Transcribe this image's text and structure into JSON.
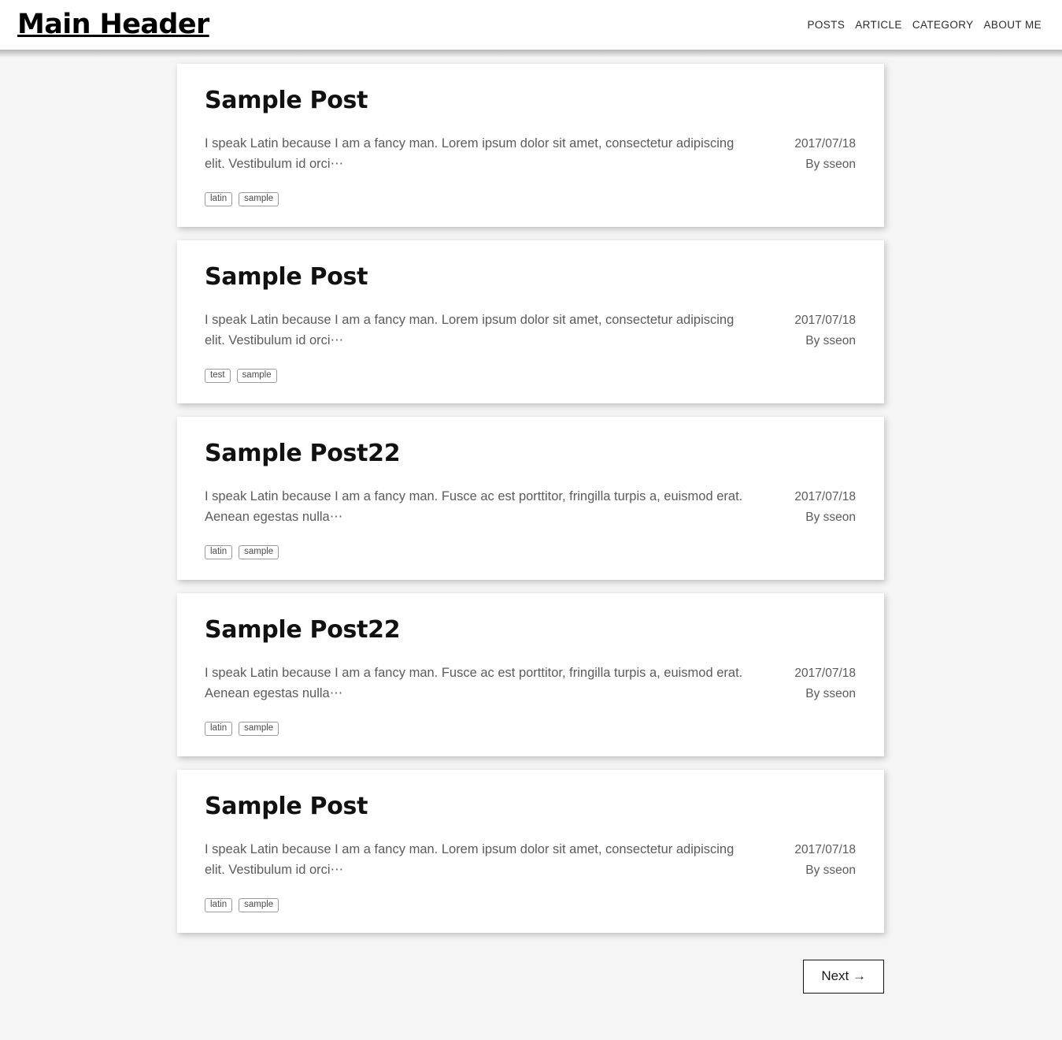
{
  "header": {
    "title": "Main Header",
    "nav": [
      {
        "label": "POSTS",
        "name": "nav-link-posts"
      },
      {
        "label": "ARTICLE",
        "name": "nav-link-article"
      },
      {
        "label": "CATEGORY",
        "name": "nav-link-category"
      },
      {
        "label": "ABOUT ME",
        "name": "nav-link-about-me"
      }
    ]
  },
  "posts": [
    {
      "title": "Sample Post",
      "excerpt": "I speak Latin because I am a fancy man. Lorem ipsum dolor sit amet, consectetur adipiscing elit. Vestibulum id orci⋯",
      "date": "2017/07/18",
      "author": "By sseon",
      "tags": [
        "latin",
        "sample"
      ]
    },
    {
      "title": "Sample Post",
      "excerpt": "I speak Latin because I am a fancy man. Lorem ipsum dolor sit amet, consectetur adipiscing elit. Vestibulum id orci⋯",
      "date": "2017/07/18",
      "author": "By sseon",
      "tags": [
        "test",
        "sample"
      ]
    },
    {
      "title": "Sample Post22",
      "excerpt": "I speak Latin because I am a fancy man. Fusce ac est porttitor, fringilla turpis a, euismod erat. Aenean egestas nulla⋯",
      "date": "2017/07/18",
      "author": "By sseon",
      "tags": [
        "latin",
        "sample"
      ]
    },
    {
      "title": "Sample Post22",
      "excerpt": "I speak Latin because I am a fancy man. Fusce ac est porttitor, fringilla turpis a, euismod erat. Aenean egestas nulla⋯",
      "date": "2017/07/18",
      "author": "By sseon",
      "tags": [
        "latin",
        "sample"
      ]
    },
    {
      "title": "Sample Post",
      "excerpt": "I speak Latin because I am a fancy man. Lorem ipsum dolor sit amet, consectetur adipiscing elit. Vestibulum id orci⋯",
      "date": "2017/07/18",
      "author": "By sseon",
      "tags": [
        "latin",
        "sample"
      ]
    }
  ],
  "pagination": {
    "next_label": "Next →"
  },
  "colors": {
    "page_background": "#f5f5f5",
    "card_background": "#ffffff",
    "title_text": "#111111",
    "body_text": "#5b5b5b",
    "tag_border": "#9a9a9a"
  }
}
